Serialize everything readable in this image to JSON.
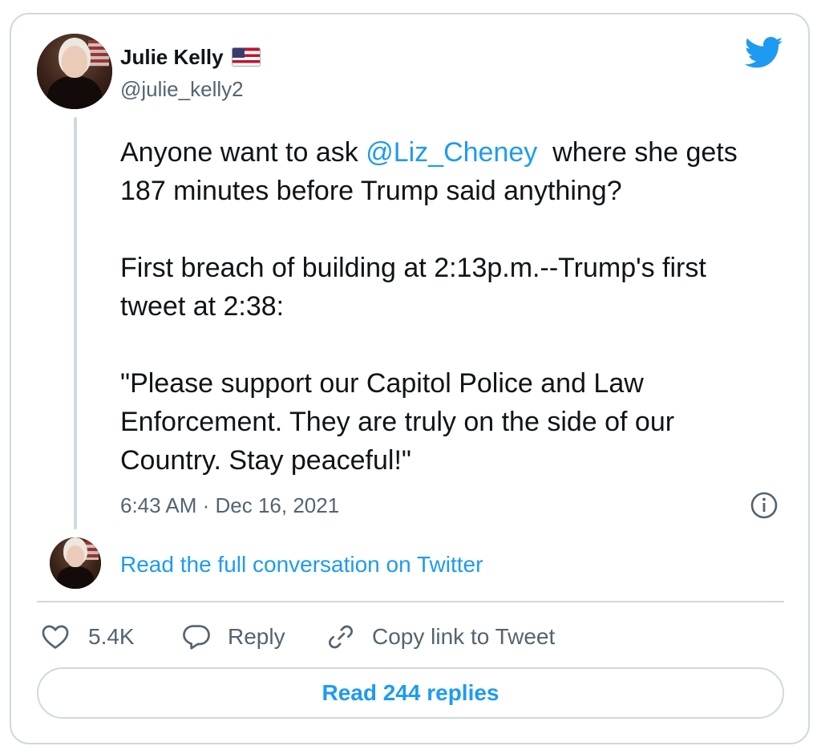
{
  "author": {
    "name": "Julie Kelly",
    "handle": "@julie_kelly2",
    "flag_icon": "us-flag-emoji"
  },
  "tweet": {
    "paragraphs": [
      {
        "before": "Anyone want to ask ",
        "mention": "@Liz_Cheney",
        "after": "  where she gets 187 minutes before Trump said anything?"
      },
      {
        "text": "First breach of building at 2:13p.m.--Trump's first tweet at 2:38:"
      },
      {
        "text": "\"Please support our Capitol Police and Law Enforcement. They are truly on the side of our Country. Stay peaceful!\""
      }
    ],
    "timestamp": "6:43 AM · Dec 16, 2021"
  },
  "conversation_link": "Read the full conversation on Twitter",
  "actions": {
    "like_count": "5.4K",
    "reply_label": "Reply",
    "copy_label": "Copy link to Tweet"
  },
  "replies_button": "Read 244 replies",
  "colors": {
    "accent": "#1d9bf0",
    "text": "#0f1419",
    "secondary": "#536471",
    "border": "#cfd9de"
  },
  "icons": [
    "twitter-bird-icon",
    "info-icon",
    "heart-icon",
    "reply-bubble-icon",
    "link-icon"
  ]
}
